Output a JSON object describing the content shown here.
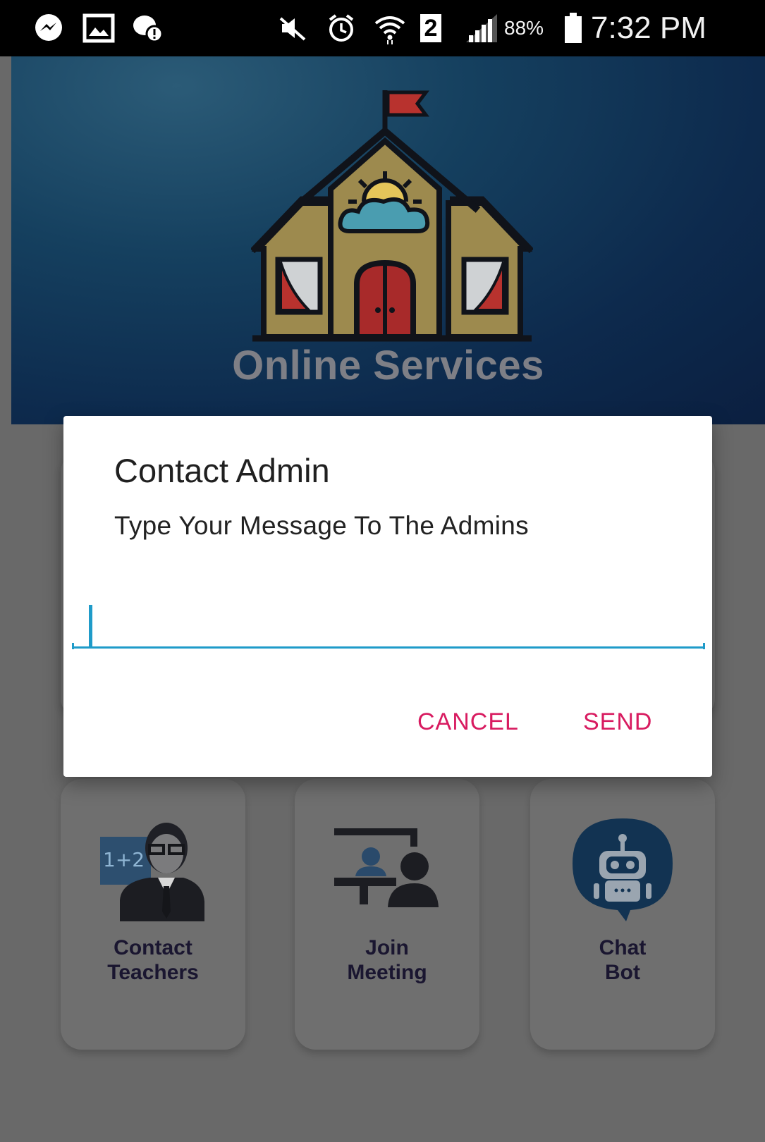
{
  "status_bar": {
    "sim_slot": "2",
    "battery_percent": "88%",
    "time": "7:32 PM",
    "icons": [
      "messenger-icon",
      "image-icon",
      "chat-alert-icon",
      "mute-icon",
      "alarm-icon",
      "wifi-icon",
      "signal-icon",
      "battery-icon"
    ]
  },
  "header": {
    "title": "Online Services",
    "logo_icon": "school-house-icon"
  },
  "dialog": {
    "title": "Contact Admin",
    "message": "Type Your Message To The Admins",
    "input_value": "",
    "cancel_label": "CANCEL",
    "send_label": "SEND",
    "accent_color": "#1f9bc9",
    "button_color": "#d81b60"
  },
  "cards": [
    {
      "line1": "Contact",
      "line2": "Teachers",
      "icon": "teacher-icon"
    },
    {
      "line1": "Join",
      "line2": "Meeting",
      "icon": "meeting-icon"
    },
    {
      "line1": "Chat",
      "line2": "Bot",
      "icon": "robot-icon"
    }
  ]
}
